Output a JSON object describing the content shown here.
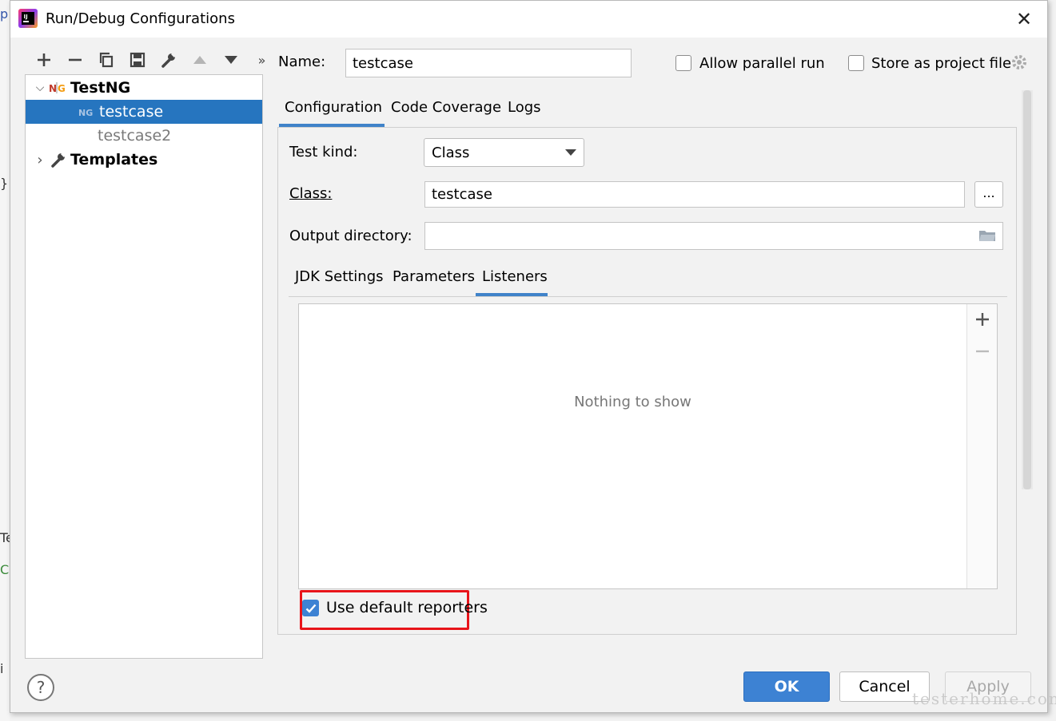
{
  "window": {
    "title": "Run/Debug Configurations",
    "close_symbol": "✕"
  },
  "background_fragments": [
    "p",
    "}",
    "Te",
    "C",
    "i"
  ],
  "left_toolbar": {
    "items": [
      {
        "icon": "plus-icon",
        "symbol": "+"
      },
      {
        "icon": "minus-icon",
        "symbol": "−"
      },
      {
        "icon": "copy-icon",
        "symbol": "⧉"
      },
      {
        "icon": "save-icon",
        "symbol": "🖫"
      },
      {
        "icon": "wrench-icon",
        "symbol": "🔧"
      },
      {
        "icon": "move-up-icon",
        "symbol": "▲"
      },
      {
        "icon": "move-down-icon",
        "symbol": "▼"
      },
      {
        "icon": "more-icon",
        "symbol": "»"
      }
    ]
  },
  "tree": {
    "testng": {
      "label": "TestNG",
      "icon_text": "NG"
    },
    "testcase": {
      "label": "testcase",
      "icon_text": "NG"
    },
    "testcase2": {
      "label": "testcase2"
    },
    "templates": {
      "label": "Templates"
    }
  },
  "form": {
    "name_label": "Name:",
    "name_value": "testcase",
    "allow_parallel_label": "Allow parallel run",
    "store_project_label": "Store as project file",
    "tabs": [
      "Configuration",
      "Code Coverage",
      "Logs"
    ],
    "test_kind_label": "Test kind:",
    "test_kind_value": "Class",
    "class_label": "Class:",
    "class_value": "testcase",
    "browse_label": "...",
    "output_dir_label": "Output directory:",
    "output_dir_value": "",
    "sub_tabs": [
      "JDK Settings",
      "Parameters",
      "Listeners"
    ],
    "list_empty_text": "Nothing to show",
    "use_default_reporters_label": "Use default reporters",
    "use_default_reporters_checked": true
  },
  "buttons": {
    "help": "?",
    "ok": "OK",
    "cancel": "Cancel",
    "apply": "Apply"
  },
  "watermark": "testerhome.com",
  "colors": {
    "selection": "#2675bf",
    "accent": "#4083c9",
    "highlight": "#e8141a"
  }
}
